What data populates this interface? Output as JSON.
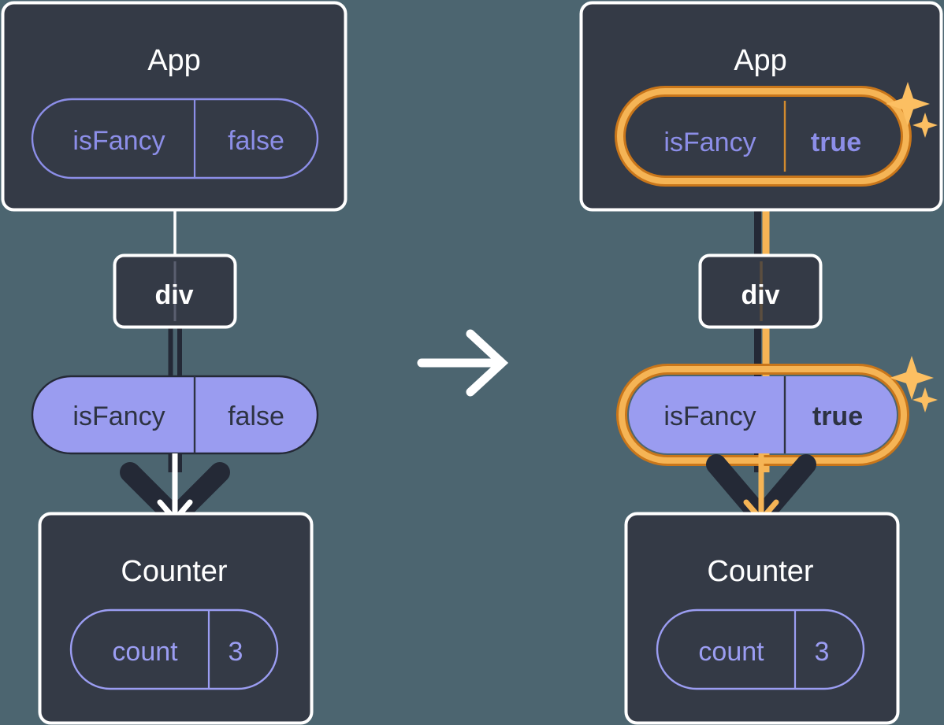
{
  "theme": {
    "background": "#4c6570",
    "card_fill": "#343a46",
    "card_stroke": "#ffffff",
    "pill_filled": "#9a9cf0",
    "pill_outline_stroke": "#8c8ee8",
    "pill_outline_text": "#8c8ee8",
    "pill_filled_text": "#2d3342",
    "edge_white": "#ffffff",
    "edge_dark": "#242936",
    "highlight_outer": "#c9761a",
    "highlight_inner": "#f5b455",
    "sparkle": "#fcbf62",
    "arrow_white": "#ffffff",
    "arrow_orange": "#f5b455",
    "title_text": "#ffffff"
  },
  "diagram": {
    "type": "react-state-propagation",
    "transition_arrow": "→",
    "panels": [
      {
        "id": "before",
        "highlighted": false,
        "nodes": [
          {
            "id": "app-before",
            "name": "App",
            "title": "App",
            "pill": {
              "key": "isFancy",
              "value": "false",
              "style": "outline",
              "highlighted": false,
              "bold_value": false
            }
          },
          {
            "id": "div-before",
            "name": "div",
            "title": "div",
            "pill": null
          },
          {
            "id": "prop-before",
            "name": "isFancy-prop",
            "title": "",
            "pill": {
              "key": "isFancy",
              "value": "false",
              "style": "filled",
              "highlighted": false,
              "bold_value": false
            }
          },
          {
            "id": "counter-before",
            "name": "Counter",
            "title": "Counter",
            "pill": {
              "key": "count",
              "value": "3",
              "style": "outline",
              "highlighted": false,
              "bold_value": false
            }
          }
        ]
      },
      {
        "id": "after",
        "highlighted": true,
        "nodes": [
          {
            "id": "app-after",
            "name": "App",
            "title": "App",
            "pill": {
              "key": "isFancy",
              "value": "true",
              "style": "outline",
              "highlighted": true,
              "bold_value": true
            }
          },
          {
            "id": "div-after",
            "name": "div",
            "title": "div",
            "pill": null
          },
          {
            "id": "prop-after",
            "name": "isFancy-prop",
            "title": "",
            "pill": {
              "key": "isFancy",
              "value": "true",
              "style": "filled",
              "highlighted": true,
              "bold_value": true
            }
          },
          {
            "id": "counter-after",
            "name": "Counter",
            "title": "Counter",
            "pill": {
              "key": "count",
              "value": "3",
              "style": "outline",
              "highlighted": false,
              "bold_value": false
            }
          }
        ]
      }
    ]
  },
  "left": {
    "app_title": "App",
    "app_pill_key": "isFancy",
    "app_pill_value": "false",
    "div_label": "div",
    "prop_pill_key": "isFancy",
    "prop_pill_value": "false",
    "counter_title": "Counter",
    "counter_pill_key": "count",
    "counter_pill_value": "3"
  },
  "right": {
    "app_title": "App",
    "app_pill_key": "isFancy",
    "app_pill_value": "true",
    "div_label": "div",
    "prop_pill_key": "isFancy",
    "prop_pill_value": "true",
    "counter_title": "Counter",
    "counter_pill_key": "count",
    "counter_pill_value": "3"
  },
  "middle": {
    "arrow_label": "right-arrow"
  }
}
